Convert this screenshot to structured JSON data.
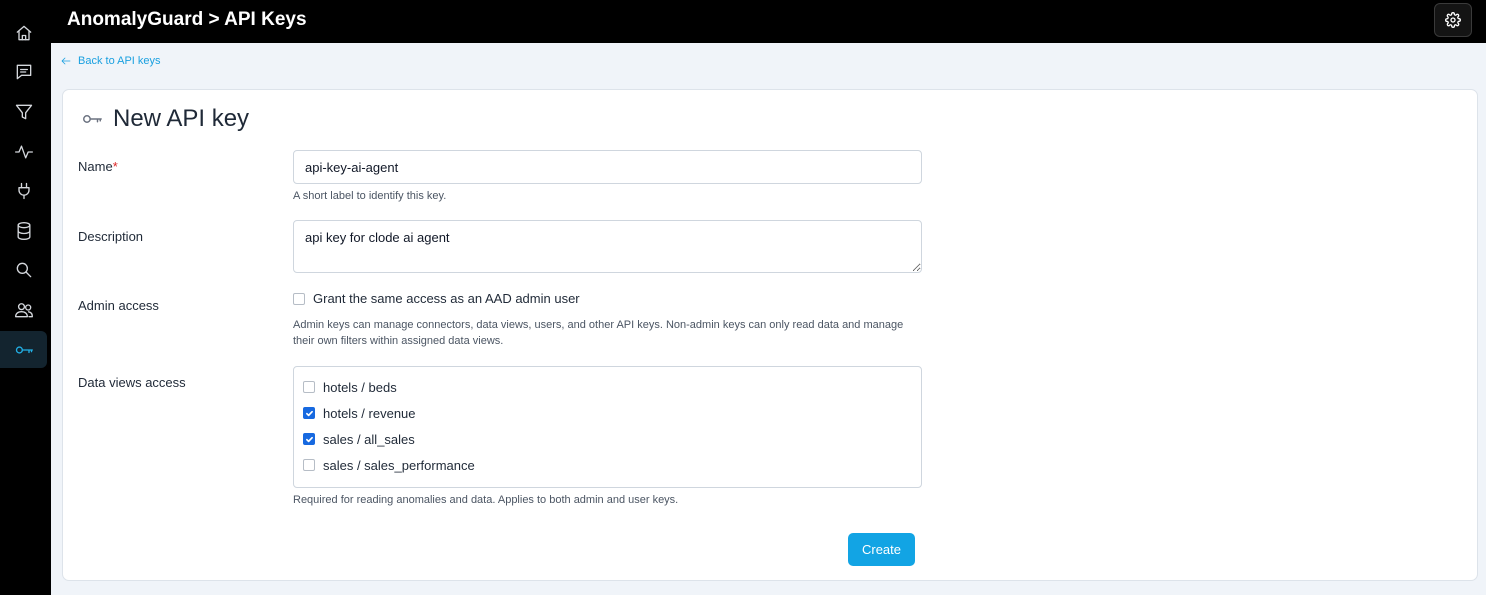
{
  "header": {
    "title": "AnomalyGuard > API Keys",
    "settings_icon": "gear-icon"
  },
  "sidebar": {
    "items": [
      {
        "icon": "home-icon",
        "active": false
      },
      {
        "icon": "chat-icon",
        "active": false
      },
      {
        "icon": "filter-icon",
        "active": false
      },
      {
        "icon": "activity-icon",
        "active": false
      },
      {
        "icon": "plug-icon",
        "active": false
      },
      {
        "icon": "database-icon",
        "active": false
      },
      {
        "icon": "search-icon",
        "active": false
      },
      {
        "icon": "users-icon",
        "active": false
      },
      {
        "icon": "key-icon",
        "active": true
      }
    ],
    "active_color": "#22b0e6"
  },
  "back_link": {
    "label": "Back to API keys"
  },
  "form": {
    "title": "New API key",
    "name": {
      "label": "Name",
      "required_mark": "*",
      "value": "api-key-ai-agent",
      "help": "A short label to identify this key."
    },
    "description": {
      "label": "Description",
      "value": "api key for clode ai agent"
    },
    "admin_access": {
      "label": "Admin access",
      "checkbox_label": "Grant the same access as an AAD admin user",
      "checked": false,
      "help": "Admin keys can manage connectors, data views, users, and other API keys. Non-admin keys can only read data and manage their own filters within assigned data views."
    },
    "data_views": {
      "label": "Data views access",
      "items": [
        {
          "label": "hotels / beds",
          "checked": false
        },
        {
          "label": "hotels / revenue",
          "checked": true
        },
        {
          "label": "sales / all_sales",
          "checked": true
        },
        {
          "label": "sales / sales_performance",
          "checked": false
        }
      ],
      "help": "Required for reading anomalies and data. Applies to both admin and user keys."
    },
    "create_label": "Create"
  },
  "colors": {
    "accent": "#12a4e4",
    "checkbox": "#1769e0",
    "required": "#dc2626"
  }
}
